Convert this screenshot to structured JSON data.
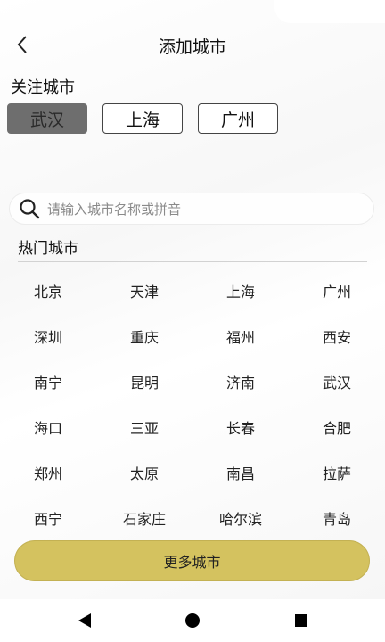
{
  "header": {
    "title": "添加城市",
    "back_icon": "chevron-left-icon"
  },
  "followed": {
    "label": "关注城市",
    "cities": [
      {
        "name": "武汉",
        "active": true
      },
      {
        "name": "上海",
        "active": false
      },
      {
        "name": "广州",
        "active": false
      }
    ]
  },
  "search": {
    "icon": "search-icon",
    "placeholder": "请输入城市名称或拼音"
  },
  "hot": {
    "label": "热门城市",
    "cities": [
      "北京",
      "天津",
      "上海",
      "广州",
      "深圳",
      "重庆",
      "福州",
      "西安",
      "南宁",
      "昆明",
      "济南",
      "武汉",
      "海口",
      "三亚",
      "长春",
      "合肥",
      "郑州",
      "太原",
      "南昌",
      "拉萨",
      "西宁",
      "石家庄",
      "哈尔滨",
      "青岛"
    ]
  },
  "more_button": {
    "label": "更多城市"
  },
  "colors": {
    "accent": "#d4c25f",
    "active_chip": "#6e6e6e"
  },
  "nav": {
    "back_icon": "triangle-back-icon",
    "home_icon": "circle-home-icon",
    "recents_icon": "square-recents-icon"
  }
}
